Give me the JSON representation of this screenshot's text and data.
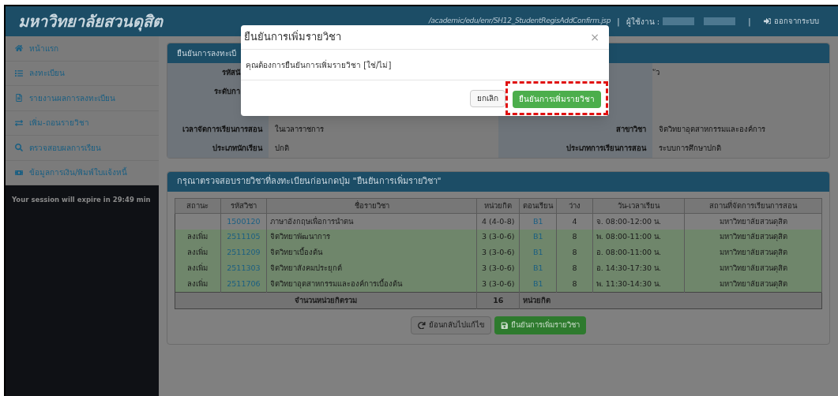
{
  "header": {
    "title": "มหาวิทยาลัยสวนดุสิต",
    "path": "/academic/edu/enr/SH12_StudentRegisAddConfirm.jsp",
    "separator": "|",
    "user_label": "ผู้ใช้งาน :",
    "separator_2": "|",
    "logout": "ออกจากระบบ"
  },
  "sidebar": {
    "items": [
      {
        "label": "หน้าแรก"
      },
      {
        "label": "ลงทะเบียน"
      },
      {
        "label": "รายงานผลการลงทะเบียน"
      },
      {
        "label": "เพิ่ม-ถอนรายวิชา"
      },
      {
        "label": "ตรวจสอบผลการเรียน"
      },
      {
        "label": "ข้อมูลการเงิน/พิมพ์ใบแจ้งหนี้"
      }
    ],
    "session": "Your session will expire in 29:49 min"
  },
  "info_panel": {
    "title": "ยืนยันการลงทะเบี",
    "rows": [
      {
        "left": {
          "label": "รหัสนั"
        },
        "right": {
          "value": "ัว"
        }
      },
      {
        "left": {
          "label": "ระดับกา"
        }
      },
      {
        "left": {
          "label": "เวลาจัดการเรียนการสอน",
          "value": "ในเวลาราชการ"
        },
        "right": {
          "label": "สาขาวิชา",
          "value": "จิตวิทยาอุตสาหกรรมและองค์การ"
        }
      },
      {
        "left": {
          "label": "ประเภทนักเรียน",
          "value": "ปกติ"
        },
        "right": {
          "label": "ประเภทการเรียนการสอน",
          "value": "ระบบการศึกษาปกติ"
        }
      }
    ]
  },
  "courses_panel": {
    "title": "กรุณาตรวจสอบรายวิชาที่ลงทะเบียนก่อนกดปุ่ม \"ยืนยันการเพิ่มรายวิชา\"",
    "table": {
      "columns": [
        "สถานะ",
        "รหัสวิชา",
        "ชื่อรายวิชา",
        "หน่วยกิต",
        "ตอนเรียน",
        "ว่าง",
        "วัน-เวลาเรียน",
        "สถานที่จัดการเรียนการสอน"
      ],
      "rows": [
        {
          "highlighted": false,
          "cells": [
            "",
            "1500120",
            "ภาษาอังกฤษเพื่อการนำตน",
            "4 (4-0-8)",
            "B1",
            "4",
            "จ. 08:00-12:00 น.",
            "มหาวิทยาลัยสวนดุสิต"
          ]
        },
        {
          "highlighted": true,
          "cells": [
            "ลงเพิ่ม",
            "2511105",
            "จิตวิทยาพัฒนาการ",
            "3 (3-0-6)",
            "B1",
            "8",
            "พ. 08:00-11:00 น.",
            "มหาวิทยาลัยสวนดุสิต"
          ]
        },
        {
          "highlighted": true,
          "cells": [
            "ลงเพิ่ม",
            "2511209",
            "จิตวิทยาเบื้องต้น",
            "3 (3-0-6)",
            "B1",
            "8",
            "อ. 08:00-11:00 น.",
            "มหาวิทยาลัยสวนดุสิต"
          ]
        },
        {
          "highlighted": true,
          "cells": [
            "ลงเพิ่ม",
            "2511303",
            "จิตวิทยาสังคมประยุกต์",
            "3 (3-0-6)",
            "B1",
            "8",
            "อ. 14:30-17:30 น.",
            "มหาวิทยาลัยสวนดุสิต"
          ]
        },
        {
          "highlighted": true,
          "cells": [
            "ลงเพิ่ม",
            "2511706",
            "จิตวิทยาอุตสาหกรรมและองค์การเบื้องต้น",
            "3 (3-0-6)",
            "B1",
            "8",
            "พ. 11:30-14:30 น.",
            "มหาวิทยาลัยสวนดุสิต"
          ]
        }
      ],
      "total": {
        "label": "จำนวนหน่วยกิตรวม",
        "value": "16",
        "unit": "หน่วยกิต"
      }
    },
    "back_button": "ย้อนกลับไปแก้ไข",
    "confirm_button": "ยืนยันการเพิ่มรายวิชา"
  },
  "dialog": {
    "title": "ยืนยันการเพิ่มรายวิชา",
    "close": "×",
    "message": "คุณต้องการยืนยันการเพิ่มรายวิชา [ใช่/ไม่]",
    "cancel": "ยกเลิก",
    "confirm": "ยืนยันการเพิ่มรายวิชา",
    "confirm_highlighted": true
  }
}
